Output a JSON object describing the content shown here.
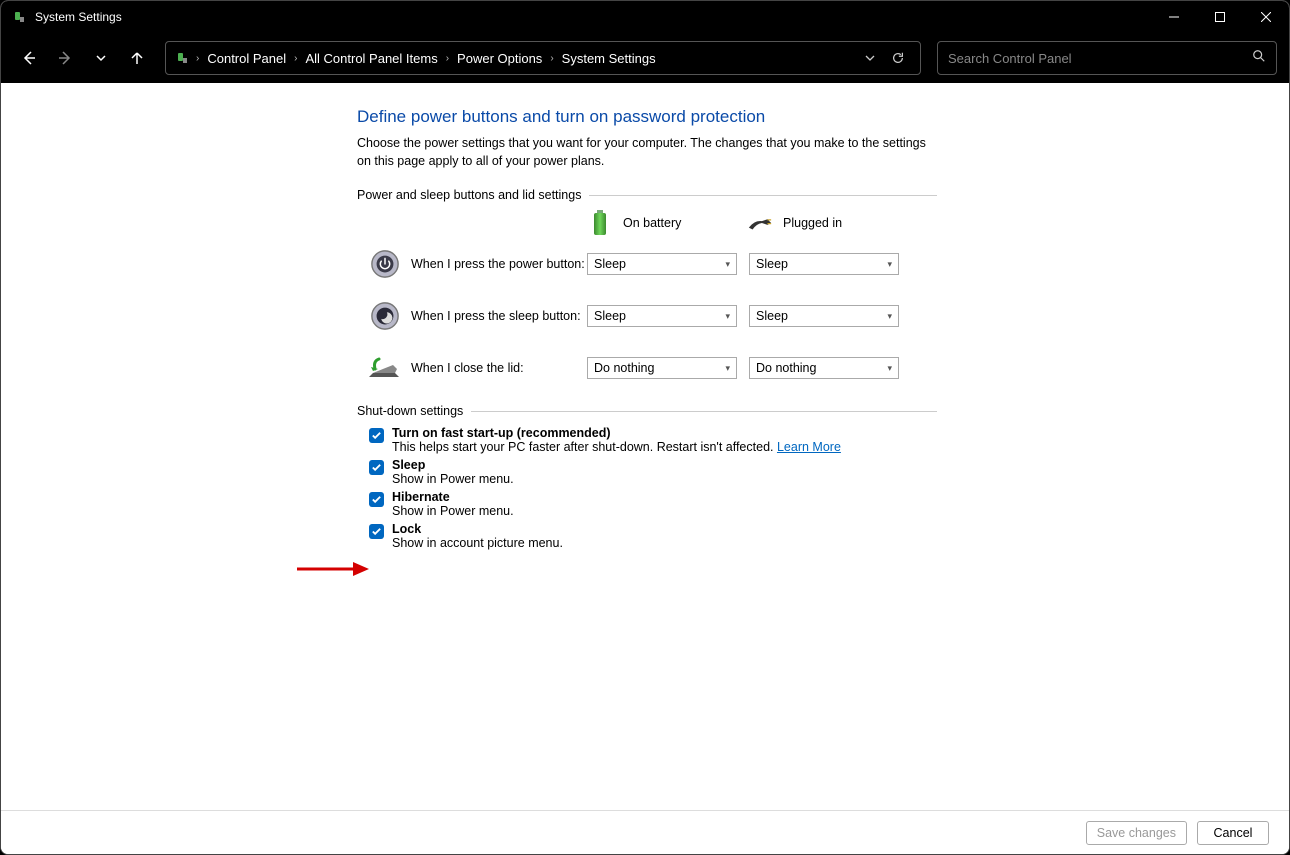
{
  "window": {
    "title": "System Settings"
  },
  "breadcrumb": {
    "items": [
      "Control Panel",
      "All Control Panel Items",
      "Power Options",
      "System Settings"
    ]
  },
  "search": {
    "placeholder": "Search Control Panel"
  },
  "page": {
    "heading": "Define power buttons and turn on password protection",
    "description": "Choose the power settings that you want for your computer. The changes that you make to the settings on this page apply to all of your power plans."
  },
  "power_section": {
    "legend": "Power and sleep buttons and lid settings",
    "columns": {
      "battery": "On battery",
      "plugged": "Plugged in"
    },
    "rows": [
      {
        "label": "When I press the power button:",
        "battery": "Sleep",
        "plugged": "Sleep"
      },
      {
        "label": "When I press the sleep button:",
        "battery": "Sleep",
        "plugged": "Sleep"
      },
      {
        "label": "When I close the lid:",
        "battery": "Do nothing",
        "plugged": "Do nothing"
      }
    ]
  },
  "shutdown_section": {
    "legend": "Shut-down settings",
    "items": [
      {
        "title": "Turn on fast start-up (recommended)",
        "sub_pre": "This helps start your PC faster after shut-down. Restart isn't affected. ",
        "link": "Learn More",
        "checked": true
      },
      {
        "title": "Sleep",
        "sub": "Show in Power menu.",
        "checked": true
      },
      {
        "title": "Hibernate",
        "sub": "Show in Power menu.",
        "checked": true
      },
      {
        "title": "Lock",
        "sub": "Show in account picture menu.",
        "checked": true
      }
    ]
  },
  "footer": {
    "save": "Save changes",
    "cancel": "Cancel"
  }
}
